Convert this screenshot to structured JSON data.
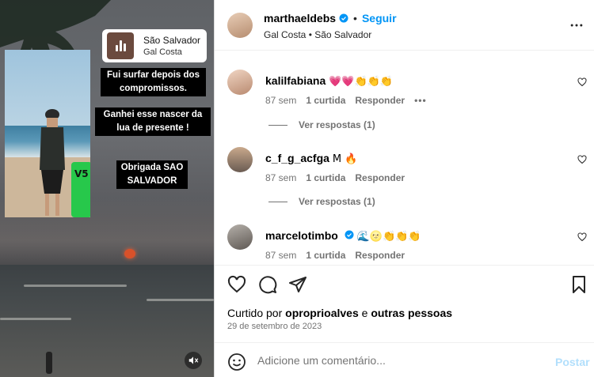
{
  "post": {
    "username": "marthaeldebs",
    "follow_label": "Seguir",
    "dot": "•",
    "subtitle": "Gal Costa • São Salvador",
    "accent_color": "#0095f6"
  },
  "media": {
    "music": {
      "song": "São Salvador",
      "artist": "Gal Costa"
    },
    "captions": [
      "Fui surfar depois dos\ncompromissos.",
      "Ganhei esse nascer da\nlua de presente !",
      "Obrigada SAO\nSALVADOR"
    ],
    "board_label": "V5"
  },
  "comments": [
    {
      "user": "kalilfabiana",
      "text": "💗💗👏👏👏",
      "age": "87 sem",
      "likes": "1 curtida",
      "reply": "Responder",
      "more": "•••",
      "replies": "Ver respostas (1)"
    },
    {
      "user": "c_f_g_acfga",
      "text": "M 🔥",
      "age": "87 sem",
      "likes": "1 curtida",
      "reply": "Responder",
      "replies": "Ver respostas (1)"
    },
    {
      "user": "marcelotimbo",
      "text": "🌊🌝👏👏👏",
      "age": "87 sem",
      "likes": "1 curtida",
      "reply": "Responder"
    }
  ],
  "footer": {
    "liked_prefix": "Curtido por",
    "liked_user": "oproprioalves",
    "liked_join": "e",
    "liked_others": "outras pessoas",
    "date": "29 de setembro de 2023",
    "comment_placeholder": "Adicione um comentário...",
    "post_label": "Postar"
  }
}
